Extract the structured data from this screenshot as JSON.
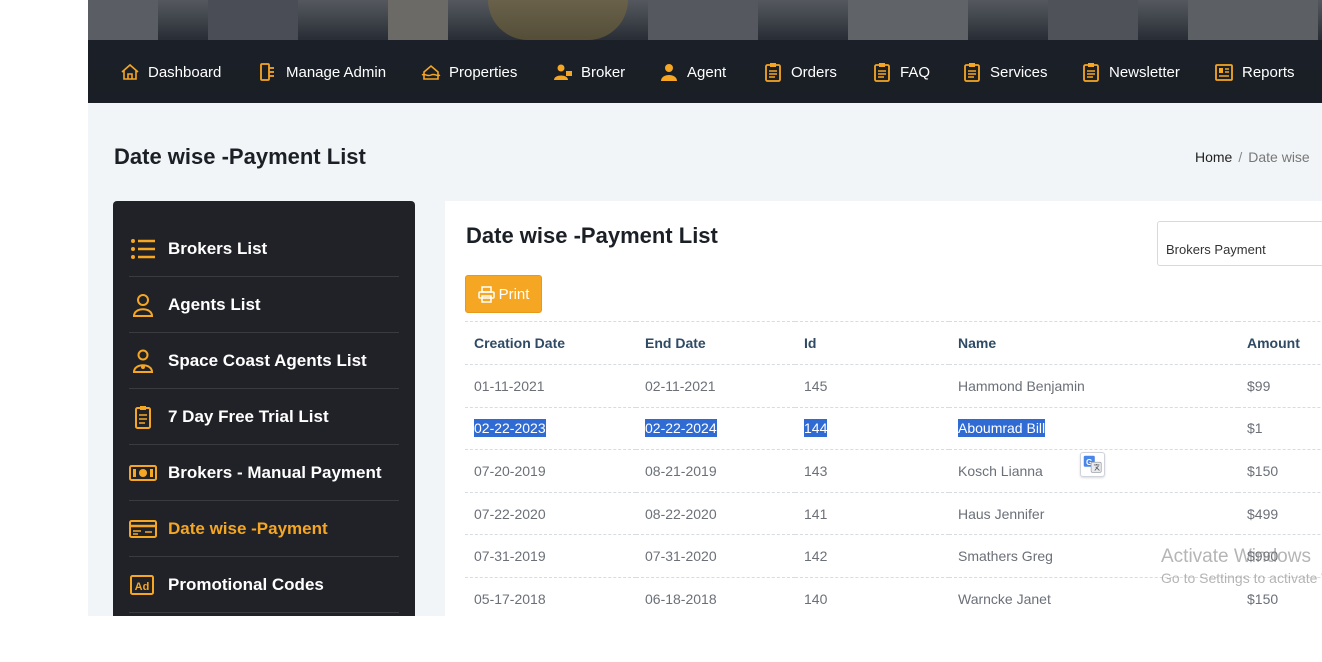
{
  "nav": {
    "items": [
      {
        "label": "Dashboard",
        "icon": "home-icon"
      },
      {
        "label": "Manage Admin",
        "icon": "admin-icon"
      },
      {
        "label": "Properties",
        "icon": "properties-icon"
      },
      {
        "label": "Broker",
        "icon": "broker-icon"
      },
      {
        "label": "Agent",
        "icon": "agent-icon"
      },
      {
        "label": "Orders",
        "icon": "clipboard-icon"
      },
      {
        "label": "FAQ",
        "icon": "clipboard-icon"
      },
      {
        "label": "Services",
        "icon": "clipboard-icon"
      },
      {
        "label": "Newsletter",
        "icon": "clipboard-icon"
      },
      {
        "label": "Reports",
        "icon": "reports-icon"
      }
    ]
  },
  "page": {
    "title": "Date wise -Payment List",
    "breadcrumb": {
      "home": "Home",
      "separator": "/",
      "current": "Date wise"
    }
  },
  "sidebar": {
    "items": [
      {
        "label": "Brokers List",
        "icon": "list-icon",
        "active": false
      },
      {
        "label": "Agents List",
        "icon": "user-icon",
        "active": false
      },
      {
        "label": "Space Coast Agents List",
        "icon": "user-location-icon",
        "active": false
      },
      {
        "label": "7 Day Free Trial List",
        "icon": "clipboard-icon",
        "active": false
      },
      {
        "label": "Brokers - Manual Payment",
        "icon": "money-icon",
        "active": false
      },
      {
        "label": "Date wise -Payment",
        "icon": "payment-card-icon",
        "active": true
      },
      {
        "label": "Promotional Codes",
        "icon": "ad-icon",
        "active": false
      }
    ]
  },
  "card": {
    "title": "Date wise -Payment List",
    "filter_value": "Brokers Payment",
    "print_label": "Print"
  },
  "table": {
    "columns": [
      "Creation Date",
      "End Date",
      "Id",
      "Name",
      "Amount"
    ],
    "rows": [
      {
        "creation": "01-11-2021",
        "end": "02-11-2021",
        "id": "145",
        "name": "Hammond Benjamin",
        "amount": "$99",
        "selected": false
      },
      {
        "creation": "02-22-2023",
        "end": "02-22-2024",
        "id": "144",
        "name": "Aboumrad Bill",
        "amount": "$1",
        "selected": true
      },
      {
        "creation": "07-20-2019",
        "end": "08-21-2019",
        "id": "143",
        "name": "Kosch Lianna",
        "amount": "$150",
        "selected": false
      },
      {
        "creation": "07-22-2020",
        "end": "08-22-2020",
        "id": "141",
        "name": "Haus Jennifer",
        "amount": "$499",
        "selected": false
      },
      {
        "creation": "07-31-2019",
        "end": "07-31-2020",
        "id": "142",
        "name": "Smathers Greg",
        "amount": "$990",
        "selected": false
      },
      {
        "creation": "05-17-2018",
        "end": "06-18-2018",
        "id": "140",
        "name": "Warncke Janet",
        "amount": "$150",
        "selected": false
      }
    ]
  },
  "watermark": {
    "line1": "Activate Windows",
    "line2": "Go to Settings to activate Windows."
  },
  "colors": {
    "accent": "#f5a623",
    "nav_bg": "#1f232b",
    "sidebar_bg": "#212227",
    "selection": "#2f6bd3"
  }
}
